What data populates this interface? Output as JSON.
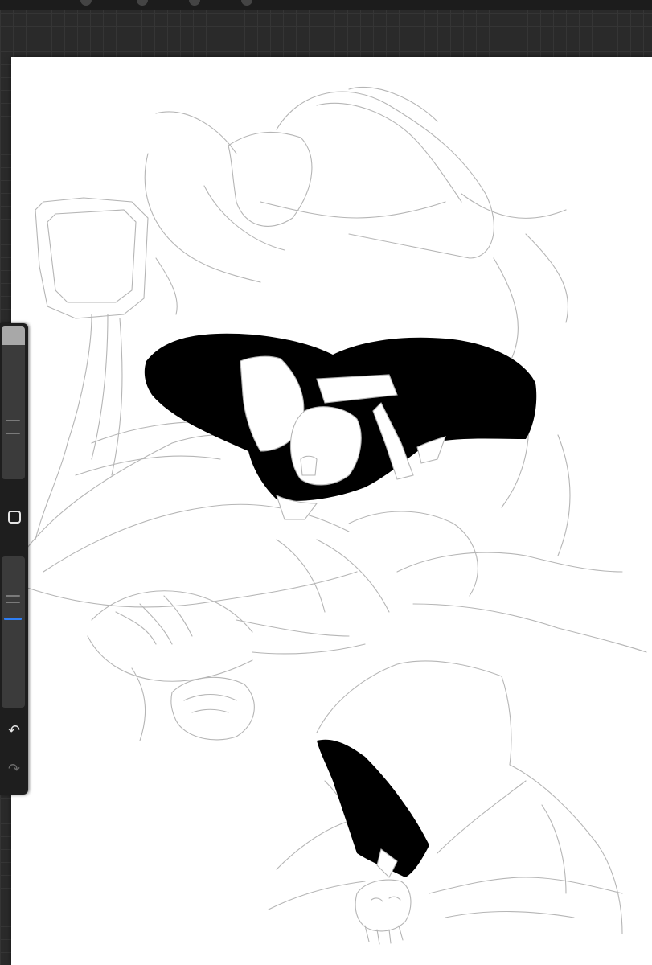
{
  "app": {
    "view": "drawing-canvas"
  },
  "sidebar": {
    "brush_size_level": 0.12,
    "opacity_level": 0.38,
    "tools": [
      {
        "name": "modify-button",
        "icon": "square-icon"
      },
      {
        "name": "undo-button",
        "icon": "undo-arrow-icon"
      },
      {
        "name": "redo-button",
        "icon": "redo-arrow-icon"
      }
    ]
  },
  "colors": {
    "workspace": "#2a2a2a",
    "canvas": "#ffffff",
    "ink": "#000000",
    "sketch_line": "#b5b5b5",
    "accent": "#2f7ff5"
  }
}
